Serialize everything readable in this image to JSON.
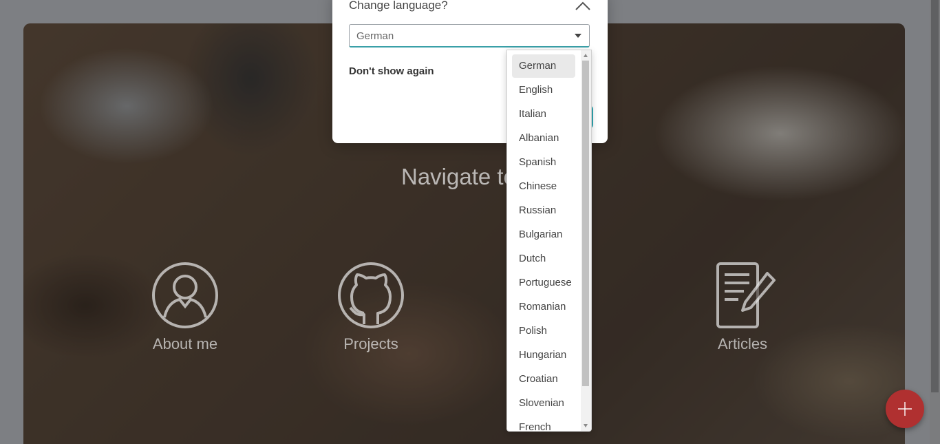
{
  "hero": {
    "title": "Navigate to",
    "nav": [
      {
        "label": "About me",
        "icon": "user-icon"
      },
      {
        "label": "Projects",
        "icon": "github-icon"
      },
      {
        "label": "Articles",
        "icon": "document-edit-icon"
      }
    ]
  },
  "modal": {
    "title": "Change language?",
    "selected_language": "German",
    "dont_show_again": "Don't show again"
  },
  "dropdown": {
    "options": [
      "German",
      "English",
      "Italian",
      "Albanian",
      "Spanish",
      "Chinese",
      "Russian",
      "Bulgarian",
      "Dutch",
      "Portuguese",
      "Romanian",
      "Polish",
      "Hungarian",
      "Croatian",
      "Slovenian",
      "French"
    ],
    "selected_index": 0
  },
  "fab": {
    "icon": "plus-icon"
  },
  "colors": {
    "accent": "#2fa6b0",
    "fab": "#b03030"
  }
}
